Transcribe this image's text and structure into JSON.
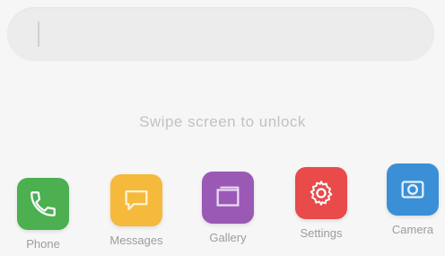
{
  "search": {
    "value": ""
  },
  "hint_text": "Swipe screen to unlock",
  "apps": [
    {
      "label": "Phone",
      "icon": "phone-icon",
      "color": "#4caf50"
    },
    {
      "label": "Messages",
      "icon": "message-icon",
      "color": "#f5b93c"
    },
    {
      "label": "Gallery",
      "icon": "gallery-icon",
      "color": "#9b59b6"
    },
    {
      "label": "Settings",
      "icon": "gear-icon",
      "color": "#e94a4a"
    },
    {
      "label": "Camera",
      "icon": "camera-icon",
      "color": "#3b8fd6"
    }
  ]
}
